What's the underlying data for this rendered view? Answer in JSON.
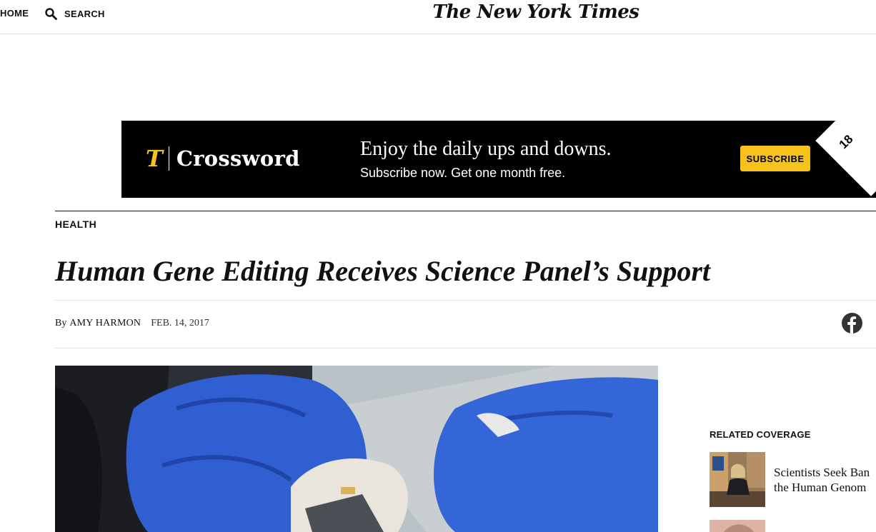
{
  "nav": {
    "home_label": "HOME",
    "search_label": "SEARCH",
    "masthead": "The New York Times"
  },
  "ad": {
    "logo_mark": "T",
    "logo_word": "Crossword",
    "headline": "Enjoy the daily ups and downs.",
    "subline": "Subscribe now. Get one month free.",
    "button_label": "SUBSCRIBE",
    "badge": "18",
    "colors": {
      "background": "#000000",
      "accent": "#f6c21c"
    }
  },
  "article": {
    "section": "HEALTH",
    "headline": "Human Gene Editing Receives Science Panel’s Support",
    "byline_prefix": "By",
    "author": "AMY HARMON",
    "date": "FEB. 14, 2017",
    "share_icon": "facebook-icon"
  },
  "related": {
    "title": "RELATED COVERAGE",
    "items": [
      {
        "text_line1": "Scientists Seek Ban",
        "text_line2": "the Human Genom"
      }
    ]
  }
}
